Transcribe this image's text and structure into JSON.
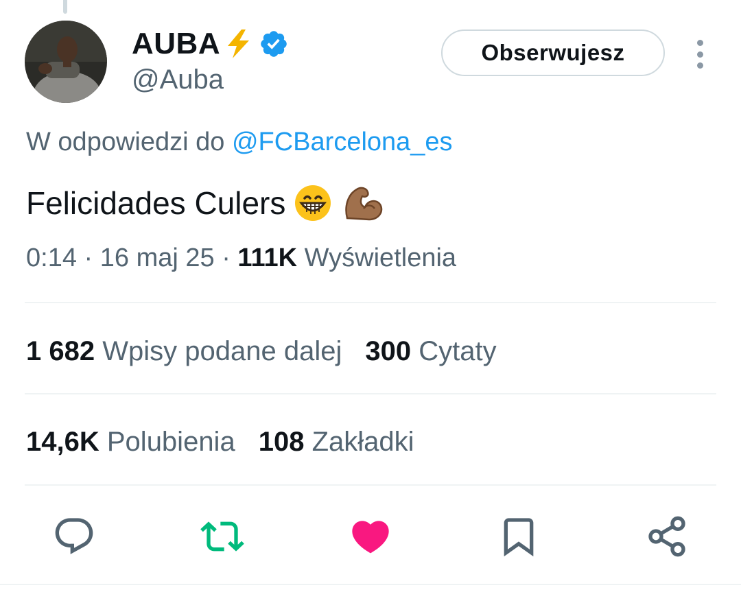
{
  "author": {
    "display_name": "AUBA",
    "name_emoji": "⚡",
    "handle": "@Auba",
    "verified": true
  },
  "follow_button": {
    "label": "Obserwujesz"
  },
  "reply_context": {
    "prefix": "W odpowiedzi do",
    "mention": "@FCBarcelona_es"
  },
  "tweet": {
    "text": "Felicidades Culers",
    "emojis": [
      "grinning-face",
      "flexed-biceps"
    ]
  },
  "meta": {
    "time": "0:14",
    "sep1": "·",
    "date": "16 maj 25",
    "sep2": "·",
    "views_count": "111K",
    "views_label": "Wyświetlenia"
  },
  "stats": {
    "reposts_count": "1 682",
    "reposts_label": "Wpisy podane dalej",
    "quotes_count": "300",
    "quotes_label": "Cytaty",
    "likes_count": "14,6K",
    "likes_label": "Polubienia",
    "bookmarks_count": "108",
    "bookmarks_label": "Zakładki"
  },
  "actions": [
    {
      "icon": "reply-icon"
    },
    {
      "icon": "repost-icon",
      "color": "#00ba7c"
    },
    {
      "icon": "like-icon",
      "color": "#f91880",
      "active": true
    },
    {
      "icon": "bookmark-icon"
    },
    {
      "icon": "share-icon"
    }
  ],
  "colors": {
    "accent": "#1d9bf0",
    "muted": "#536471",
    "text": "#0f1419"
  }
}
